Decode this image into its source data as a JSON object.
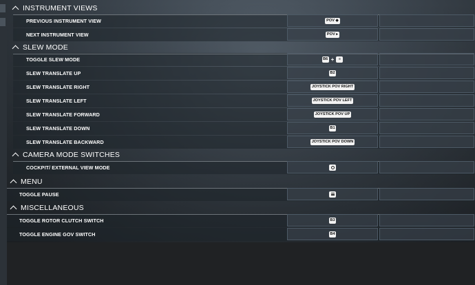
{
  "sections": [
    {
      "title": "INSTRUMENT VIEWS",
      "items": [
        {
          "label": "PREVIOUS INSTRUMENT VIEW",
          "binding": {
            "keys": [
              "POV ◆"
            ],
            "icon": "pov-left-icon"
          }
        },
        {
          "label": "NEXT INSTRUMENT VIEW",
          "binding": {
            "keys": [
              "POV ▸"
            ],
            "icon": "pov-right-icon"
          }
        }
      ]
    },
    {
      "title": "SLEW MODE",
      "items": [
        {
          "label": "TOGGLE SLEW MODE",
          "binding": {
            "keys": [
              "B6",
              "+",
              "≡"
            ],
            "icon": "button-combo-icon"
          }
        },
        {
          "label": "SLEW TRANSLATE UP",
          "binding": {
            "keys": [
              "B2"
            ],
            "icon": "button-icon"
          }
        },
        {
          "label": "SLEW TRANSLATE RIGHT",
          "binding": {
            "keys": [
              "JOYSTICK POV RIGHT"
            ]
          }
        },
        {
          "label": "SLEW TRANSLATE LEFT",
          "binding": {
            "keys": [
              "JOYSTICK POV LEFT"
            ]
          }
        },
        {
          "label": "SLEW TRANSLATE FORWARD",
          "binding": {
            "keys": [
              "JOYSTICK POV UP"
            ]
          }
        },
        {
          "label": "SLEW TRANSLATE DOWN",
          "binding": {
            "keys": [
              "B1"
            ],
            "icon": "button-icon"
          }
        },
        {
          "label": "SLEW TRANSLATE BACKWARD",
          "binding": {
            "keys": [
              "JOYSTICK POV DOWN"
            ]
          }
        }
      ]
    },
    {
      "title": "CAMERA MODE SWITCHES",
      "items": [
        {
          "label": "COCKPIT/ EXTERNAL VIEW MODE",
          "binding": {
            "keys": [
              ""
            ],
            "icon": "camera-switch-icon"
          }
        }
      ]
    },
    {
      "title": "MENU",
      "items": [
        {
          "label": "TOGGLE PAUSE",
          "binding": {
            "keys": [
              ""
            ],
            "icon": "menu-icon"
          }
        }
      ]
    },
    {
      "title": "MISCELLANEOUS",
      "items": [
        {
          "label": "TOGGLE ROTOR CLUTCH SWITCH",
          "binding": {
            "keys": [
              "B3"
            ],
            "icon": "button-icon"
          }
        },
        {
          "label": "TOGGLE ENGINE GOV SWITCH",
          "binding": {
            "keys": [
              "B4"
            ],
            "icon": "button-icon"
          }
        }
      ]
    }
  ]
}
